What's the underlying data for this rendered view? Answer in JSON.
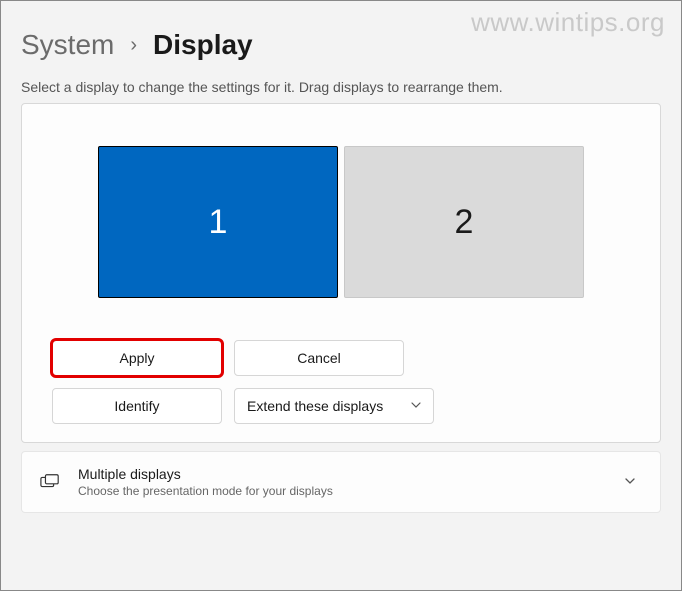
{
  "watermark": "www.wintips.org",
  "breadcrumb": {
    "parent": "System",
    "current": "Display"
  },
  "helper_text": "Select a display to change the settings for it. Drag displays to rearrange them.",
  "monitors": {
    "display1": "1",
    "display2": "2"
  },
  "buttons": {
    "apply": "Apply",
    "cancel": "Cancel",
    "identify": "Identify"
  },
  "dropdown": {
    "selected": "Extend these displays"
  },
  "card": {
    "title": "Multiple displays",
    "subtitle": "Choose the presentation mode for your displays"
  }
}
